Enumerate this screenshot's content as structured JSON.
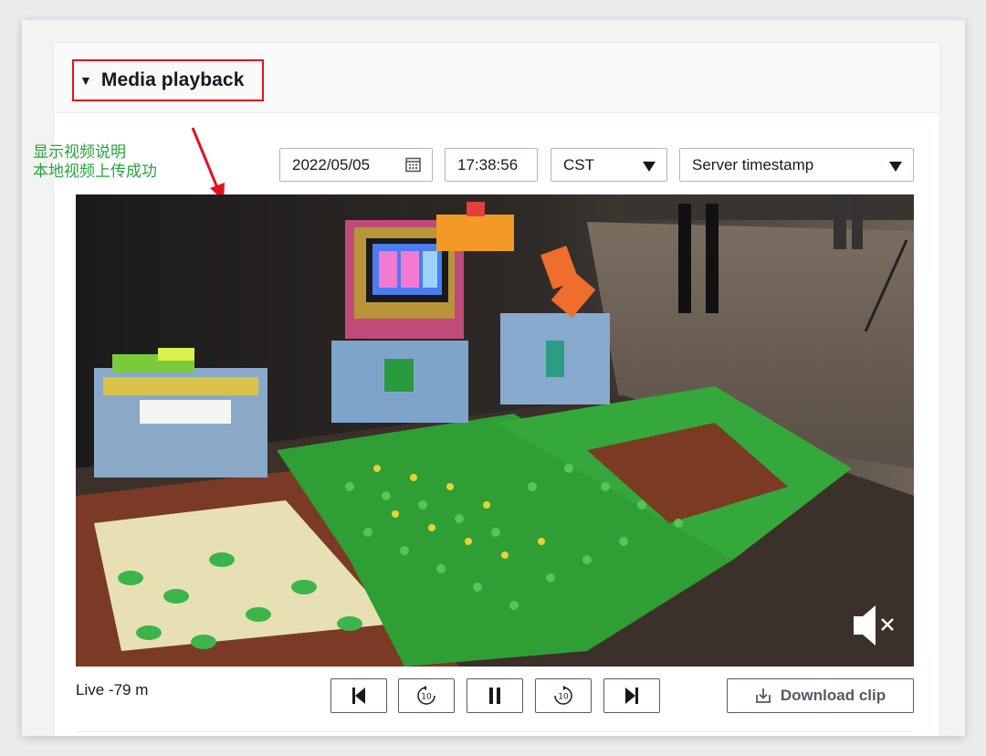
{
  "section": {
    "title": "Media playback",
    "caret_icon": "caret-down-icon"
  },
  "annotation": {
    "line1": "显示视频说明",
    "line2": "本地视频上传成功",
    "color": "#24a43a",
    "arrow_color": "#e0141c"
  },
  "filters": {
    "date": "2022/05/05",
    "time": "17:38:56",
    "timezone": "CST",
    "timestamp_type": "Server timestamp"
  },
  "player": {
    "status": "Live -79 m",
    "muted": true,
    "download_label": "Download clip"
  },
  "colors": {
    "highlight_border": "#e0141c",
    "button_border": "#545b64",
    "input_border": "#aab7b8"
  }
}
